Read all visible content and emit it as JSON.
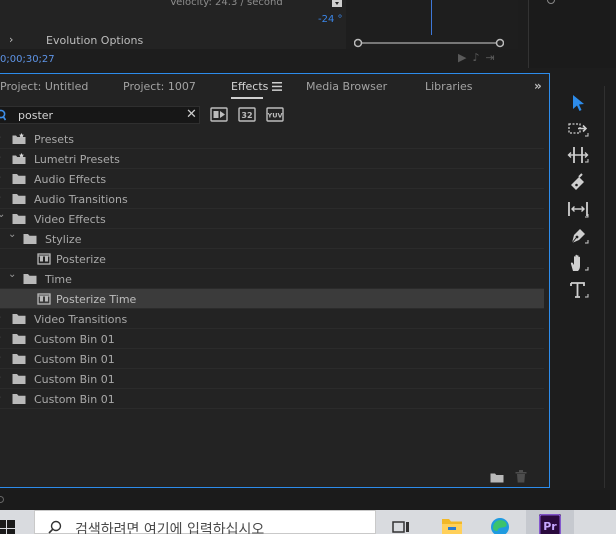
{
  "effect_controls": {
    "velocity_text": "Velocity: 24.3 / second",
    "degrees_value": "-24 °",
    "evolution_label": "Evolution Options",
    "timecode": "0;00;30;27"
  },
  "tabs": [
    {
      "label": "Project: Untitled"
    },
    {
      "label": "Project: 1007"
    },
    {
      "label": "Effects"
    },
    {
      "label": "Media Browser"
    },
    {
      "label": "Libraries"
    }
  ],
  "tab_overflow": "»",
  "search": {
    "value": "poster",
    "clear_glyph": "✕"
  },
  "filters": [
    "accelerated-effects",
    "32-bit-color",
    "yuv"
  ],
  "tree": [
    {
      "label": "Presets",
      "type": "folder-star",
      "level": 0,
      "expanded": false,
      "selected": false
    },
    {
      "label": "Lumetri Presets",
      "type": "folder-star",
      "level": 0,
      "expanded": false,
      "selected": false
    },
    {
      "label": "Audio Effects",
      "type": "folder",
      "level": 0,
      "expanded": false,
      "selected": false
    },
    {
      "label": "Audio Transitions",
      "type": "folder",
      "level": 0,
      "expanded": false,
      "selected": false
    },
    {
      "label": "Video Effects",
      "type": "folder",
      "level": 0,
      "expanded": true,
      "selected": false
    },
    {
      "label": "Stylize",
      "type": "folder",
      "level": 1,
      "expanded": true,
      "selected": false
    },
    {
      "label": "Posterize",
      "type": "effect",
      "level": 2,
      "expanded": false,
      "selected": false
    },
    {
      "label": "Time",
      "type": "folder",
      "level": 1,
      "expanded": true,
      "selected": false
    },
    {
      "label": "Posterize Time",
      "type": "effect",
      "level": 2,
      "expanded": false,
      "selected": true
    },
    {
      "label": "Video Transitions",
      "type": "folder",
      "level": 0,
      "expanded": false,
      "selected": false
    },
    {
      "label": "Custom Bin 01",
      "type": "folder",
      "level": 0,
      "expanded": false,
      "selected": false
    },
    {
      "label": "Custom Bin 01",
      "type": "folder",
      "level": 0,
      "expanded": false,
      "selected": false
    },
    {
      "label": "Custom Bin 01",
      "type": "folder",
      "level": 0,
      "expanded": false,
      "selected": false
    },
    {
      "label": "Custom Bin 01",
      "type": "folder",
      "level": 0,
      "expanded": false,
      "selected": false
    }
  ],
  "tools": [
    "selection",
    "track-select-forward",
    "ripple-edit",
    "razor",
    "slip",
    "pen",
    "hand",
    "type"
  ],
  "taskbar": {
    "search_placeholder": "검색하려면 여기에 입력하십시오",
    "pr_label": "Pr"
  },
  "colors": {
    "accent": "#2d8ceb",
    "panel_bg": "#232323",
    "selected_row": "#3b3b3b",
    "timecode": "#5e94e6"
  }
}
